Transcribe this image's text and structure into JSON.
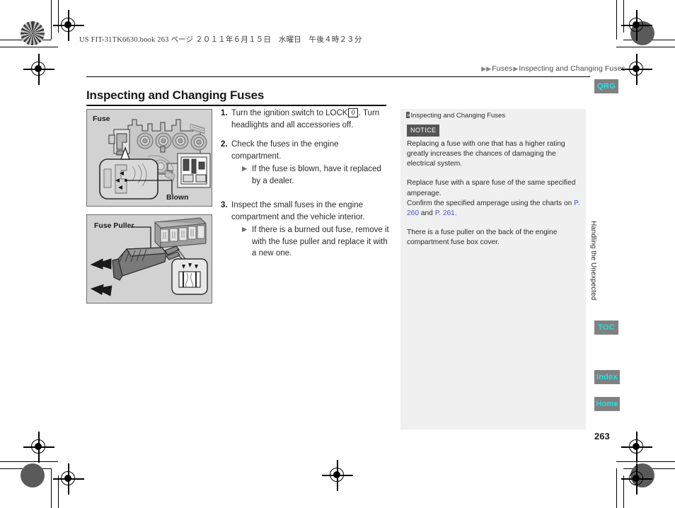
{
  "document": {
    "book_stamp": "US FIT-31TK6630.book  263 ページ  ２０１１年６月１５日　水曜日　午後４時２３分",
    "page_number": "263",
    "chapter_tab": "Handling the Unexpected"
  },
  "breadcrumb": {
    "marker": "▶▶",
    "level1": "Fuses",
    "separator": "▶",
    "level2": "Inspecting and Changing Fuses"
  },
  "title": "Inspecting and Changing Fuses",
  "figures": [
    {
      "id": "fuse",
      "label": "Fuse",
      "callout": "Blown"
    },
    {
      "id": "fuse-puller",
      "label": "Fuse Puller"
    }
  ],
  "steps": [
    {
      "num": "1.",
      "text_before": "Turn the ignition switch to LOCK",
      "icon": "0",
      "text_after": ". Turn headlights and all accessories off.",
      "substeps": []
    },
    {
      "num": "2.",
      "text_before": "Check the fuses in the engine compartment.",
      "icon": "",
      "text_after": "",
      "substeps": [
        {
          "marker": "▶",
          "text": "If the fuse is blown, have it replaced by a dealer."
        }
      ]
    },
    {
      "num": "3.",
      "text_before": "Inspect the small fuses in the engine compartment and the vehicle interior.",
      "icon": "",
      "text_after": "",
      "substeps": [
        {
          "marker": "▶",
          "text": "If there is a burned out fuse, remove it with the fuse puller and replace it with a new one."
        }
      ]
    }
  ],
  "notice_panel": {
    "marker": "»",
    "heading": "Inspecting and Changing Fuses",
    "badge": "NOTICE",
    "paragraph1": "Replacing a fuse with one that has a higher rating greatly increases the chances of damaging the electrical system.",
    "paragraph2": "Replace fuse with a spare fuse of the same specified amperage.",
    "paragraph3_before": "Confirm the specified amperage using the charts on",
    "ref1": "P. 260",
    "paragraph3_mid": "and",
    "ref2": "P. 261",
    "paragraph3_after": ".",
    "paragraph4": "There is a fuse puller on the back of the engine compartment fuse box cover."
  },
  "tabs": [
    {
      "id": "qrg",
      "label": "QRG"
    },
    {
      "id": "toc",
      "label": "TOC"
    },
    {
      "id": "index",
      "label": "Index"
    },
    {
      "id": "home",
      "label": "Home"
    }
  ],
  "colors": {
    "tab_background": "#808080",
    "tab_text": "#1fe3e3",
    "panel_background": "#f0f0f0",
    "figure_background": "#d2d2d2",
    "link": "#4a57c8",
    "badge": "#555555"
  }
}
